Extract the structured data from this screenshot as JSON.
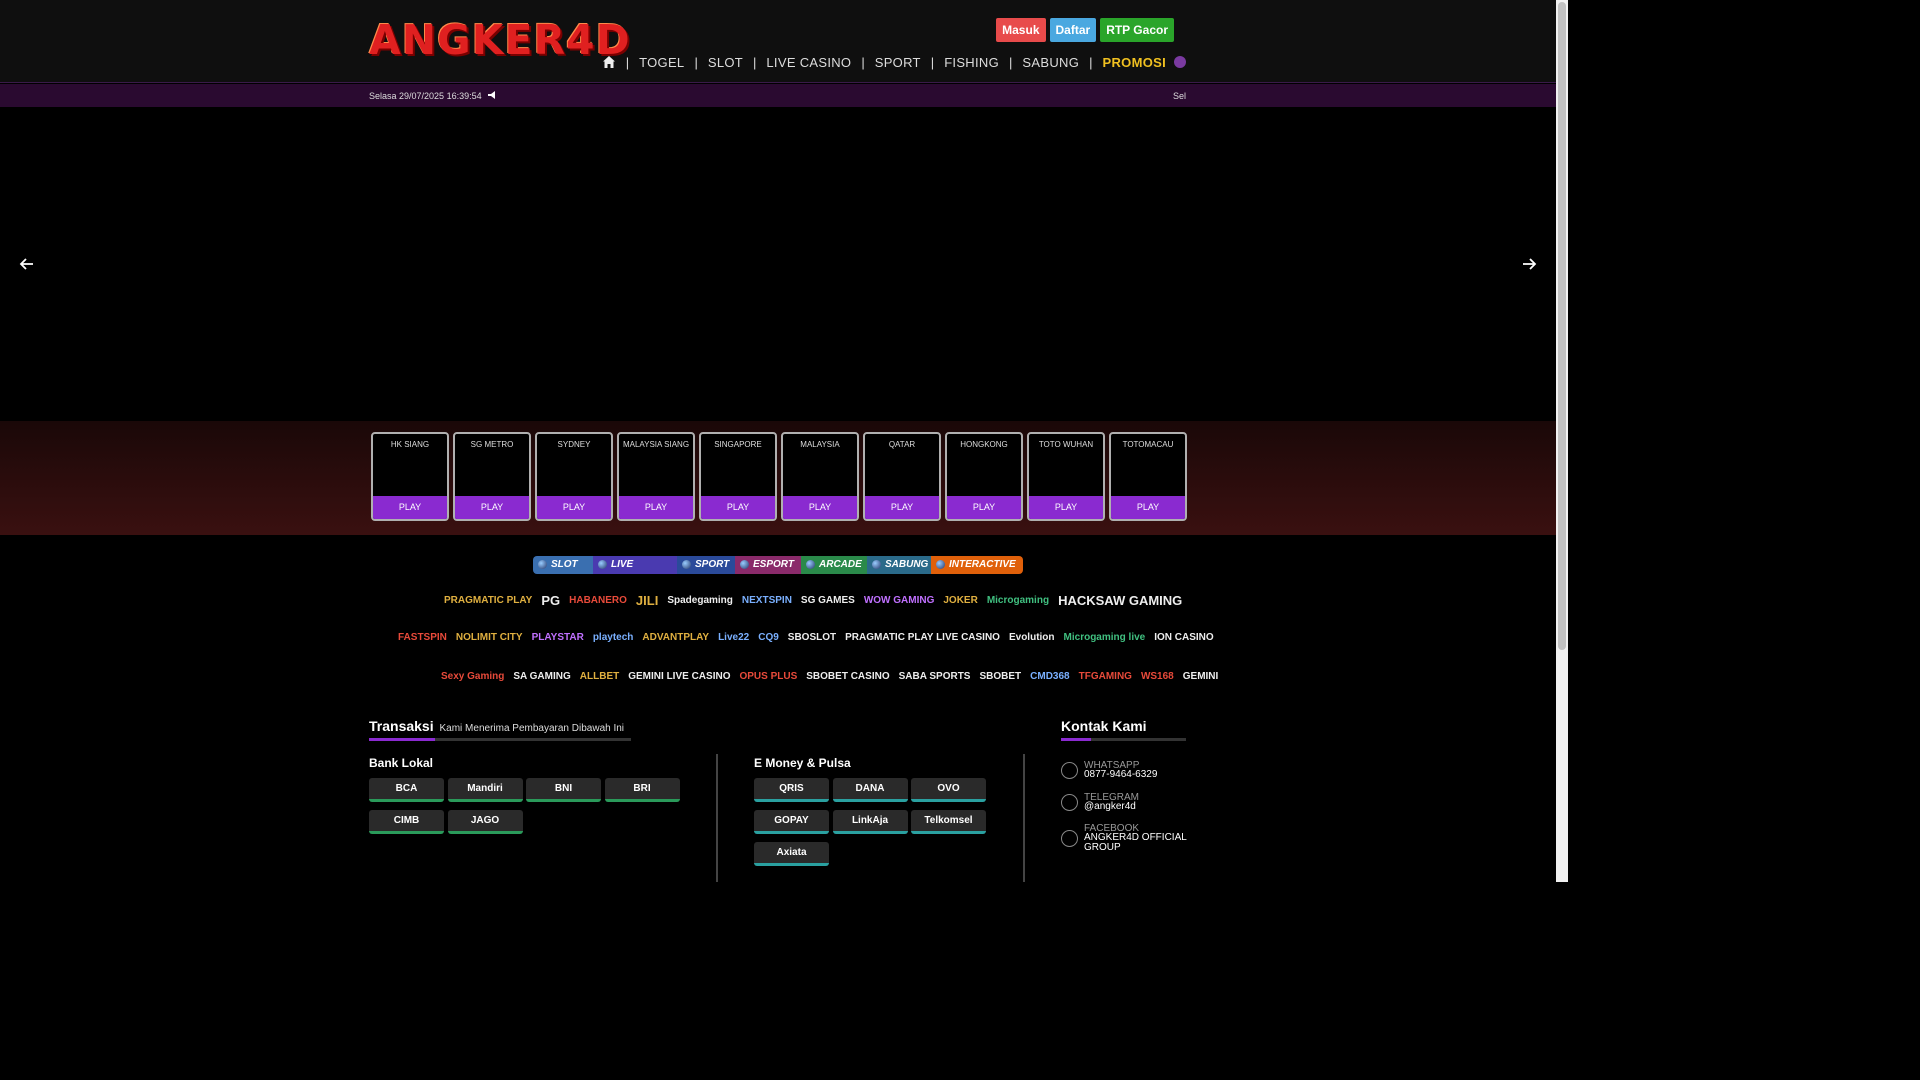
{
  "header": {
    "logo_text": "ANGKER4D",
    "auth": {
      "login": "Masuk",
      "register": "Daftar",
      "rtp": "RTP Gacor"
    },
    "nav": [
      "TOGEL",
      "SLOT",
      "LIVE CASINO",
      "SPORT",
      "FISHING",
      "SABUNG",
      "PROMOSI"
    ],
    "separator": "|"
  },
  "infobar": {
    "datetime": "Selasa 29/07/2025 16:39:54",
    "marquee": "Sel"
  },
  "lottery": {
    "play_label": "PLAY",
    "markets": [
      "HK SIANG",
      "SG METRO",
      "SYDNEY",
      "MALAYSIA SIANG",
      "SINGAPORE",
      "MALAYSIA",
      "QATAR",
      "HONGKONG",
      "TOTO WUHAN",
      "TOTOMACAU"
    ]
  },
  "providers": {
    "tabs": [
      "SLOT",
      "LIVE CASINO",
      "SPORT",
      "ESPORT",
      "ARCADE",
      "SABUNG",
      "INTERACTIVE"
    ],
    "row1": [
      "PRAGMATIC PLAY",
      "PG",
      "HABANERO",
      "JILI",
      "Spadegaming",
      "NEXTSPIN",
      "SG GAMES",
      "WOW GAMING",
      "JOKER",
      "Microgaming",
      "HACKSAW GAMING"
    ],
    "row2": [
      "FASTSPIN",
      "NOLIMIT CITY",
      "PLAYSTAR",
      "playtech",
      "ADVANTPLAY",
      "Live22",
      "CQ9",
      "SBOSLOT",
      "PRAGMATIC PLAY LIVE CASINO",
      "Evolution",
      "Microgaming live",
      "ION CASINO"
    ],
    "row3": [
      "Sexy Gaming",
      "SA GAMING",
      "ALLBET",
      "GEMINI LIVE CASINO",
      "OPUS PLUS",
      "SBOBET CASINO",
      "SABA SPORTS",
      "SBOBET",
      "CMD368",
      "TFGAMING",
      "WS168",
      "GEMINI"
    ]
  },
  "footer": {
    "transaksi_title": "Transaksi",
    "transaksi_sub": "Kami Menerima Pembayaran Dibawah Ini",
    "bank_title": "Bank Lokal",
    "banks": [
      "BCA",
      "Mandiri",
      "BNI",
      "BRI",
      "CIMB",
      "JAGO"
    ],
    "emoney_title": "E Money & Pulsa",
    "emoney": [
      "QRIS",
      "DANA",
      "OVO",
      "GOPAY",
      "LinkAja",
      "Telkomsel",
      "Axiata"
    ],
    "contact_title": "Kontak Kami",
    "contacts": [
      {
        "label": "WHATSAPP",
        "value": "0877-9464-6329"
      },
      {
        "label": "TELEGRAM",
        "value": "@angker4d"
      },
      {
        "label": "FACEBOOK",
        "value": "ANGKER4D OFFICIAL GROUP"
      }
    ]
  },
  "colors": {
    "accent": "#8a2ad0",
    "promo": "#f0c020",
    "login": "#e84b4b",
    "register": "#4aa8e0",
    "rtp": "#2aa52a"
  }
}
